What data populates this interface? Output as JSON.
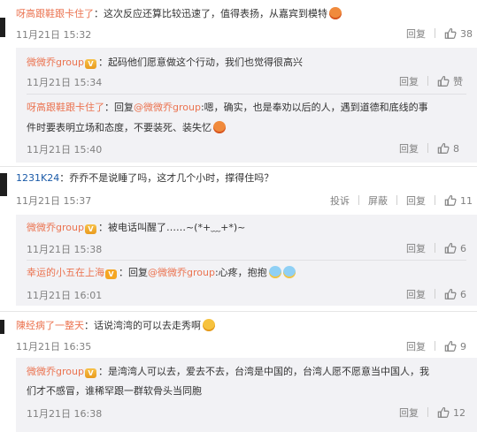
{
  "comments": [
    {
      "user": "呀高跟鞋跟卡住了",
      "text": "：这次反应还算比较迅速了，值得表扬，从嘉宾到模特",
      "time": "11月21日 15:32",
      "reply": "回复",
      "likes": "38"
    },
    {
      "user": "1231K24",
      "text": "：乔乔不是说睡了吗，这才几个小时，撑得住吗？",
      "time": "11月21日 15:37",
      "report": "投诉",
      "block": "屏蔽",
      "reply": "回复",
      "likes": "11"
    },
    {
      "user": "陳经病了一整天",
      "text": "：话说湾湾的可以去走秀啊",
      "time": "11月21日 16:35",
      "reply": "回复",
      "likes": "9"
    }
  ],
  "replies": [
    {
      "user": "微微乔group",
      "badge": "V",
      "text": "：起码他们愿意做这个行动，我们也觉得很高兴",
      "time": "11月21日 15:34",
      "reply": "回复",
      "likes": "赞"
    },
    {
      "user": "呀高跟鞋跟卡住了",
      "prefix": "：回复",
      "mention": "@微微乔group",
      "line1": ":嗯，确实，也是奉劝以后的人，遇到道德和底线的事",
      "line2": "件时要表明立场和态度，不要装死、装失忆",
      "time": "11月21日 15:40",
      "reply": "回复",
      "likes": "8"
    },
    {
      "user": "微微乔group",
      "badge": "V",
      "text": "：被电话叫醒了……~(*+﹏+*)~",
      "time": "11月21日 15:38",
      "reply": "回复",
      "likes": "6"
    },
    {
      "user": "幸运的小五在上海",
      "badge": "V",
      "prefix": "：回复",
      "mention": "@微微乔group",
      "text": ":心疼，抱抱",
      "time": "11月21日 16:01",
      "reply": "回复",
      "likes": "6"
    },
    {
      "user": "微微乔group",
      "badge": "V",
      "line1": "：是湾湾人可以去，爱去不去，台湾是中国的，台湾人愿不愿意当中国人，我",
      "line2": "们才不感冒，谁稀罕跟一群软骨头当同胞",
      "time": "11月21日 16:38",
      "reply": "回复",
      "likes": "12"
    }
  ],
  "icons": {
    "like": "thumbs-up-icon",
    "emoji": "smiley-emoji-icon",
    "badge": "member-badge-icon"
  },
  "colors": {
    "username": "#eb7350",
    "mention": "#eb7350",
    "user_blue": "#1a5aa8",
    "reply_bg": "#f2f2f5",
    "meta": "#808080"
  }
}
